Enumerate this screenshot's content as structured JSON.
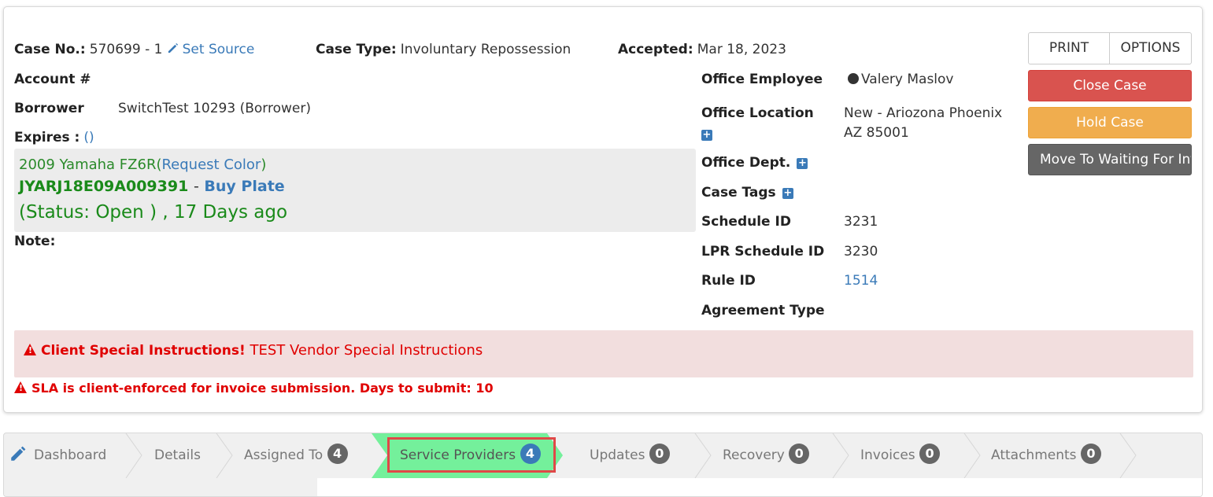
{
  "case": {
    "case_no_label": "Case No.:",
    "case_no_value": "570699 - 1",
    "set_source": "Set Source",
    "case_type_label": "Case Type:",
    "case_type_value": "Involuntary Repossession",
    "accepted_label": "Accepted:",
    "accepted_value": "Mar 18, 2023",
    "account_label": "Account #",
    "borrower_label": "Borrower",
    "borrower_value": "SwitchTest 10293 (Borrower)",
    "expires_label": "Expires :",
    "expires_value": "()",
    "note_label": "Note:"
  },
  "vehicle": {
    "year_make_model": "2009 Yamaha FZ6R",
    "open_paren": "(",
    "request_color": "Request Color",
    "close_paren": ")",
    "vin": "JYARJ18E09A009391",
    "dash": "-",
    "buy_plate": "Buy Plate",
    "status": "(Status: Open ) , 17 Days ago"
  },
  "office": {
    "employee_label": "Office Employee",
    "employee_value": "Valery Maslov",
    "location_label": "Office Location",
    "location_line1": "New - Ariozona Phoenix",
    "location_line2": "AZ 85001",
    "dept_label": "Office Dept.",
    "tags_label": "Case Tags",
    "schedule_label": "Schedule ID",
    "schedule_value": "3231",
    "lpr_label": "LPR Schedule ID",
    "lpr_value": "3230",
    "rule_label": "Rule ID",
    "rule_value": "1514",
    "agreement_label": "Agreement Type"
  },
  "buttons": {
    "print": "PRINT",
    "options": "OPTIONS",
    "close_case": "Close Case",
    "hold_case": "Hold Case",
    "move_waiting": "Move To Waiting For Info"
  },
  "alerts": {
    "client_title": "Client Special Instructions!",
    "client_text": "TEST Vendor Special Instructions",
    "sla": "SLA is client-enforced for invoice submission. Days to submit: 10"
  },
  "tabs": [
    {
      "label": "Dashboard",
      "count": null
    },
    {
      "label": "Details",
      "count": null
    },
    {
      "label": "Assigned To",
      "count": "4"
    },
    {
      "label": "Service Providers",
      "count": "4"
    },
    {
      "label": "Updates",
      "count": "0"
    },
    {
      "label": "Recovery",
      "count": "0"
    },
    {
      "label": "Invoices",
      "count": "0"
    },
    {
      "label": "Attachments",
      "count": "0"
    }
  ],
  "colors": {
    "link": "#3a7ab8",
    "green_text": "#2a8a2a",
    "active_tab": "#6ff09a",
    "danger": "#e00000",
    "highlight_border": "#e04848"
  }
}
